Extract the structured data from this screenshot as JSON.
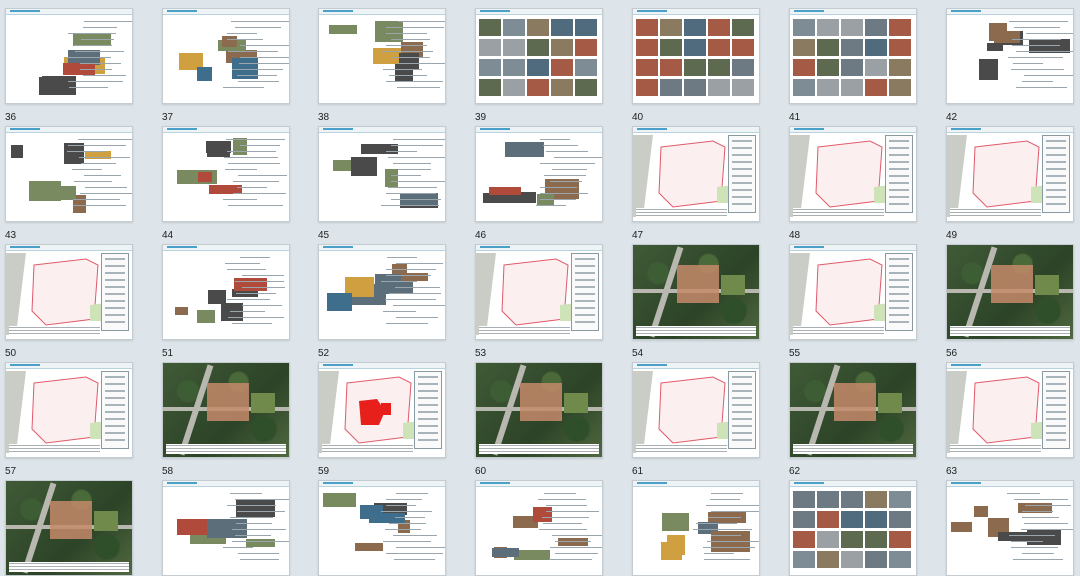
{
  "pages": [
    {
      "num": "36",
      "kind": "doc"
    },
    {
      "num": "37",
      "kind": "doc"
    },
    {
      "num": "38",
      "kind": "doc"
    },
    {
      "num": "39",
      "kind": "photo"
    },
    {
      "num": "40",
      "kind": "photo"
    },
    {
      "num": "41",
      "kind": "photo"
    },
    {
      "num": "42",
      "kind": "doc"
    },
    {
      "num": "43",
      "kind": "doc"
    },
    {
      "num": "44",
      "kind": "doc"
    },
    {
      "num": "45",
      "kind": "doc"
    },
    {
      "num": "46",
      "kind": "doc"
    },
    {
      "num": "47",
      "kind": "plan"
    },
    {
      "num": "48",
      "kind": "plan"
    },
    {
      "num": "49",
      "kind": "plan"
    },
    {
      "num": "50",
      "kind": "plan"
    },
    {
      "num": "51",
      "kind": "doc"
    },
    {
      "num": "52",
      "kind": "doc"
    },
    {
      "num": "53",
      "kind": "plan"
    },
    {
      "num": "54",
      "kind": "aerial"
    },
    {
      "num": "55",
      "kind": "plan"
    },
    {
      "num": "56",
      "kind": "aerial"
    },
    {
      "num": "57",
      "kind": "plan"
    },
    {
      "num": "58",
      "kind": "aerial"
    },
    {
      "num": "59",
      "kind": "plan-red"
    },
    {
      "num": "60",
      "kind": "aerial"
    },
    {
      "num": "61",
      "kind": "plan"
    },
    {
      "num": "62",
      "kind": "aerial"
    },
    {
      "num": "63",
      "kind": "plan"
    },
    {
      "num": "",
      "kind": "aerial"
    },
    {
      "num": "",
      "kind": "doc"
    },
    {
      "num": "",
      "kind": "doc"
    },
    {
      "num": "",
      "kind": "doc"
    },
    {
      "num": "",
      "kind": "doc"
    },
    {
      "num": "",
      "kind": "photo"
    },
    {
      "num": "",
      "kind": "doc"
    }
  ],
  "colors": {
    "background": "#dde5ea",
    "header_accent": "#4aa0c8",
    "plan_boundary": "#e05a6a",
    "highlight_red": "#e8201c"
  }
}
